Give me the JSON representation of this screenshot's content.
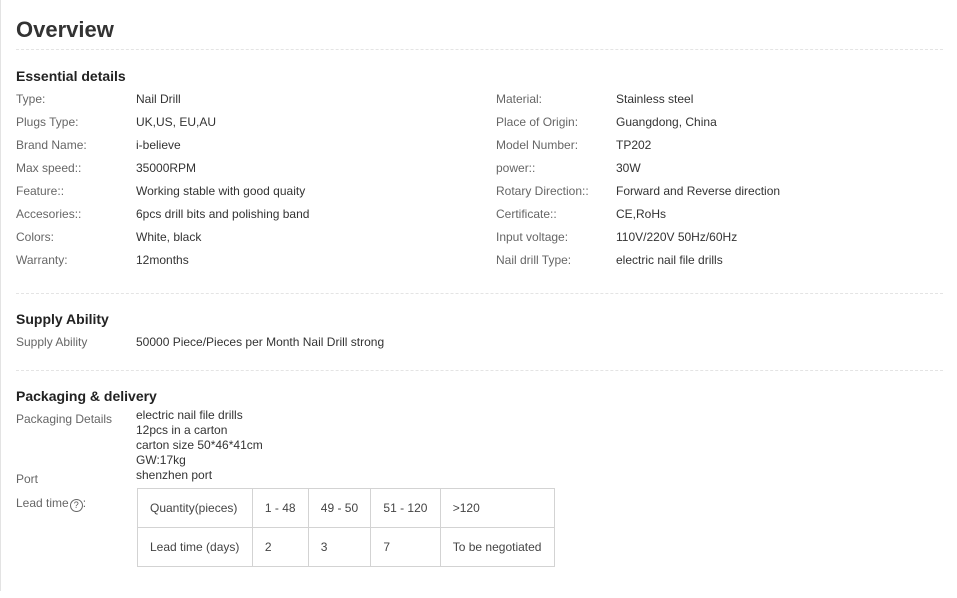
{
  "page": {
    "title": "Overview"
  },
  "essential": {
    "heading": "Essential details",
    "left": [
      {
        "label": "Type:",
        "value": "Nail Drill"
      },
      {
        "label": "Plugs Type:",
        "value": "UK,US, EU,AU"
      },
      {
        "label": "Brand Name:",
        "value": "i-believe"
      },
      {
        "label": "Max speed::",
        "value": "35000RPM"
      },
      {
        "label": "Feature::",
        "value": "Working stable with good quaity"
      },
      {
        "label": "Accesories::",
        "value": "6pcs drill bits and polishing band"
      },
      {
        "label": "Colors:",
        "value": "White, black"
      },
      {
        "label": "Warranty:",
        "value": "12months"
      }
    ],
    "right": [
      {
        "label": "Material:",
        "value": "Stainless steel"
      },
      {
        "label": "Place of Origin:",
        "value": "Guangdong, China"
      },
      {
        "label": "Model Number:",
        "value": "TP202"
      },
      {
        "label": "power::",
        "value": "30W"
      },
      {
        "label": "Rotary Direction::",
        "value": "Forward and Reverse direction"
      },
      {
        "label": "Certificate::",
        "value": "CE,RoHs"
      },
      {
        "label": "Input voltage:",
        "value": "110V/220V 50Hz/60Hz"
      },
      {
        "label": "Nail drill Type:",
        "value": "electric nail file drills"
      }
    ]
  },
  "supply": {
    "heading": "Supply Ability",
    "label": "Supply Ability",
    "value": "50000 Piece/Pieces per Month Nail Drill strong"
  },
  "packaging": {
    "heading": "Packaging & delivery",
    "details_label": "Packaging Details",
    "details_lines": [
      "electric nail file drills",
      "12pcs in a carton",
      "carton size 50*46*41cm",
      "GW:17kg"
    ],
    "port_label": "Port",
    "port_value": "shenzhen port",
    "lead_label": "Lead time",
    "help_icon": "question-circle-icon",
    "help_glyph": "?",
    "lead_table": {
      "row1": [
        "Quantity(pieces)",
        "1 - 48",
        "49 - 50",
        "51 - 120",
        ">120"
      ],
      "row2": [
        "Lead time (days)",
        "2",
        "3",
        "7",
        "To be negotiated"
      ]
    },
    "lead_suffix": ":"
  }
}
